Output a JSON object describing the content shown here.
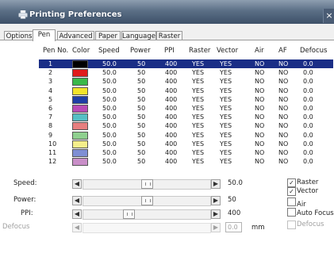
{
  "window": {
    "title": "Printing Preferences",
    "close_glyph": "×"
  },
  "tabs": [
    {
      "label": "Options",
      "active": false
    },
    {
      "label": "Pen",
      "active": true
    },
    {
      "label": "Advanced",
      "active": false
    },
    {
      "label": "Paper",
      "active": false
    },
    {
      "label": "Language",
      "active": false
    },
    {
      "label": "Raster",
      "active": false
    }
  ],
  "table": {
    "headers": [
      "Pen No.",
      "Color",
      "Speed",
      "Power",
      "PPI",
      "Raster",
      "Vector",
      "Air",
      "AF",
      "Defocus"
    ],
    "selected_pen": "1",
    "rows": [
      {
        "pen": "1",
        "color": "#000000",
        "speed": "50.0",
        "power": "50",
        "ppi": "400",
        "raster": "YES",
        "vector": "YES",
        "air": "NO",
        "af": "NO",
        "defocus": "0.0"
      },
      {
        "pen": "2",
        "color": "#e01b1b",
        "speed": "50.0",
        "power": "50",
        "ppi": "400",
        "raster": "YES",
        "vector": "YES",
        "air": "NO",
        "af": "NO",
        "defocus": "0.0"
      },
      {
        "pen": "3",
        "color": "#39b84a",
        "speed": "50.0",
        "power": "50",
        "ppi": "400",
        "raster": "YES",
        "vector": "YES",
        "air": "NO",
        "af": "NO",
        "defocus": "0.0"
      },
      {
        "pen": "4",
        "color": "#f2e32a",
        "speed": "50.0",
        "power": "50",
        "ppi": "400",
        "raster": "YES",
        "vector": "YES",
        "air": "NO",
        "af": "NO",
        "defocus": "0.0"
      },
      {
        "pen": "5",
        "color": "#1f3ea6",
        "speed": "50.0",
        "power": "50",
        "ppi": "400",
        "raster": "YES",
        "vector": "YES",
        "air": "NO",
        "af": "NO",
        "defocus": "0.0"
      },
      {
        "pen": "6",
        "color": "#b84ab6",
        "speed": "50.0",
        "power": "50",
        "ppi": "400",
        "raster": "YES",
        "vector": "YES",
        "air": "NO",
        "af": "NO",
        "defocus": "0.0"
      },
      {
        "pen": "7",
        "color": "#55bfc4",
        "speed": "50.0",
        "power": "50",
        "ppi": "400",
        "raster": "YES",
        "vector": "YES",
        "air": "NO",
        "af": "NO",
        "defocus": "0.0"
      },
      {
        "pen": "8",
        "color": "#e77f7f",
        "speed": "50.0",
        "power": "50",
        "ppi": "400",
        "raster": "YES",
        "vector": "YES",
        "air": "NO",
        "af": "NO",
        "defocus": "0.0"
      },
      {
        "pen": "9",
        "color": "#8fd08f",
        "speed": "50.0",
        "power": "50",
        "ppi": "400",
        "raster": "YES",
        "vector": "YES",
        "air": "NO",
        "af": "NO",
        "defocus": "0.0"
      },
      {
        "pen": "10",
        "color": "#f4ee8a",
        "speed": "50.0",
        "power": "50",
        "ppi": "400",
        "raster": "YES",
        "vector": "YES",
        "air": "NO",
        "af": "NO",
        "defocus": "0.0"
      },
      {
        "pen": "11",
        "color": "#7f8fd4",
        "speed": "50.0",
        "power": "50",
        "ppi": "400",
        "raster": "YES",
        "vector": "YES",
        "air": "NO",
        "af": "NO",
        "defocus": "0.0"
      },
      {
        "pen": "12",
        "color": "#c98ec8",
        "speed": "50.0",
        "power": "50",
        "ppi": "400",
        "raster": "YES",
        "vector": "YES",
        "air": "NO",
        "af": "NO",
        "defocus": "0.0"
      }
    ]
  },
  "sliders": {
    "speed": {
      "label": "Speed:",
      "value": "50.0",
      "level": 0.5,
      "enabled": true
    },
    "power": {
      "label": "Power:",
      "value": "50",
      "level": 0.5,
      "enabled": true
    },
    "ppi": {
      "label": "PPI:",
      "value": "400",
      "level": 0.35,
      "enabled": true
    },
    "defocus": {
      "label": "Defocus",
      "value": "0.0",
      "unit": "mm",
      "level": 0.0,
      "enabled": false
    }
  },
  "slider_arrows": {
    "left": "◀",
    "right": "▶"
  },
  "checkboxes": [
    {
      "key": "raster",
      "label": "Raster",
      "checked": true,
      "enabled": true
    },
    {
      "key": "vector",
      "label": "Vector",
      "checked": true,
      "enabled": true
    },
    {
      "key": "air",
      "label": "Air",
      "checked": false,
      "enabled": true
    },
    {
      "key": "auto_focus",
      "label": "Auto Focus",
      "checked": false,
      "enabled": true
    },
    {
      "key": "defocus",
      "label": "Defocus",
      "checked": false,
      "enabled": false
    }
  ],
  "check_glyph": "✓",
  "colors": {
    "selection": "#1a2e86",
    "titlebar": "#4a5c74"
  }
}
